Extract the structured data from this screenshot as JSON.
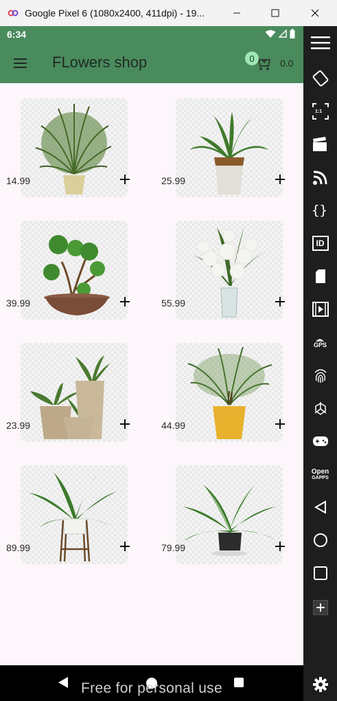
{
  "window": {
    "title": "Google Pixel 6 (1080x2400, 411dpi) - 19..."
  },
  "statusbar": {
    "time": "6:34"
  },
  "appbar": {
    "title": "FLowers shop",
    "cart_count": "0",
    "cart_total": "0.0"
  },
  "products": [
    {
      "price": "14.99",
      "icon": "palm-plant"
    },
    {
      "price": "25.99",
      "icon": "dracaena-plant"
    },
    {
      "price": "39.99",
      "icon": "bonsai-plant"
    },
    {
      "price": "55.99",
      "icon": "lily-bouquet"
    },
    {
      "price": "23.99",
      "icon": "potted-plants-group"
    },
    {
      "price": "44.99",
      "icon": "areca-palm"
    },
    {
      "price": "89.99",
      "icon": "stand-plant"
    },
    {
      "price": "79.99",
      "icon": "aglaonema-plant"
    }
  ],
  "watermark": "Free for personal use",
  "sidebar_tools": [
    "menu",
    "rotate",
    "resize",
    "screen-record",
    "cast",
    "debug",
    "device-id",
    "sd-card",
    "media",
    "gps",
    "fingerprint",
    "3d-sensor",
    "gamepad",
    "open-gapps",
    "back",
    "home",
    "recents",
    "add",
    "settings"
  ],
  "sidebar_labels": {
    "resize": "1:1",
    "id": "ID",
    "gps": "GPS",
    "open_gapps_1": "Open",
    "open_gapps_2": "GAPPS"
  },
  "colors": {
    "appbar": "#4a8b5d",
    "background": "#fdf6fb",
    "badge": "#9ee6b4"
  }
}
